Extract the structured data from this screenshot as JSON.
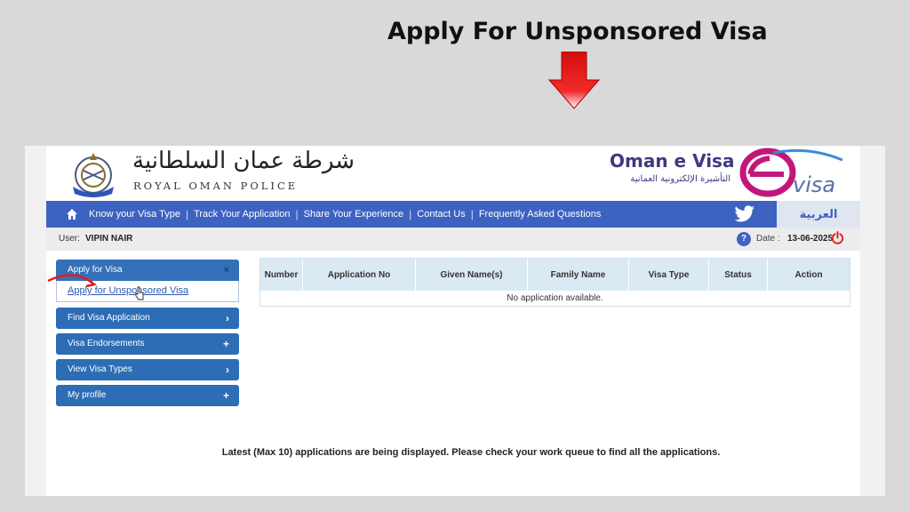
{
  "overlay": {
    "title": "Apply For Unsponsored Visa",
    "arrow_icon": "down-arrow-icon",
    "arrow_color": "#e81e1e"
  },
  "header": {
    "emblem_icon": "royal-oman-police-emblem",
    "police_arabic": "شرطة عمان السلطانية",
    "police_english": "ROYAL OMAN POLICE",
    "evisa_title": "Oman e Visa",
    "evisa_arabic": "التأشيرة الإلكترونية العمانية",
    "evisa_logo_icon": "evisa-logo",
    "evisa_logo_text": "visa"
  },
  "nav": {
    "home_icon": "home-icon",
    "links": [
      "Know your Visa Type",
      "Track Your Application",
      "Share Your Experience",
      "Contact Us",
      "Frequently Asked Questions"
    ],
    "separator": "|",
    "twitter_icon": "twitter-icon",
    "language": "العربية",
    "color": "#3e62c2"
  },
  "user_bar": {
    "user_label": "User:",
    "user_name": "VIPIN NAIR",
    "help_icon": "?",
    "date_label": "Date :",
    "date_value": "13-06-2025",
    "power_icon": "power-icon"
  },
  "sidebar": {
    "open_item": {
      "label": "Apply for Visa",
      "icon": "×",
      "sub_item": "Apply for Unsponsored Visa"
    },
    "items": [
      {
        "label": "Find Visa Application",
        "icon": "›"
      },
      {
        "label": "Visa Endorsements",
        "icon": "+"
      },
      {
        "label": "View Visa Types",
        "icon": "›"
      },
      {
        "label": "My profile",
        "icon": "+"
      }
    ]
  },
  "table": {
    "columns": [
      "Number",
      "Application No",
      "Given Name(s)",
      "Family Name",
      "Visa Type",
      "Status",
      "Action"
    ],
    "empty_message": "No application available."
  },
  "footnote": "Latest (Max 10) applications are being displayed. Please check your work queue to find all the applications."
}
